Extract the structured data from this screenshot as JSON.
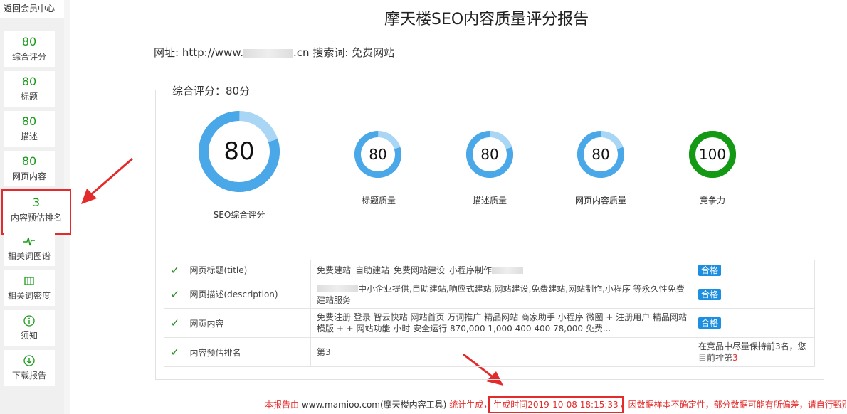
{
  "sidebar": {
    "back_label": "返回会员中心",
    "items": [
      {
        "score": "80",
        "label": "综合评分"
      },
      {
        "score": "80",
        "label": "标题"
      },
      {
        "score": "80",
        "label": "描述"
      },
      {
        "score": "80",
        "label": "网页内容"
      },
      {
        "score": "3",
        "label": "内容预估排名"
      },
      {
        "icon": "pulse-icon",
        "label": "相关词图谱"
      },
      {
        "icon": "grid-icon",
        "label": "相关词密度"
      },
      {
        "icon": "info-icon",
        "label": "须知"
      },
      {
        "icon": "download-icon",
        "label": "下载报告"
      }
    ]
  },
  "report": {
    "title": "摩天楼SEO内容质量评分报告",
    "url_label": "网址:",
    "url_prefix": "http://www.",
    "url_suffix": ".cn",
    "keyword_label": "搜索词:",
    "keyword": "免费网站"
  },
  "summary": {
    "legend": "综合评分：80分",
    "main_gauge": {
      "value": 80,
      "label": "SEO综合评分"
    },
    "gauges": [
      {
        "value": 80,
        "label": "标题质量",
        "color": "#4aa8e8"
      },
      {
        "value": 80,
        "label": "描述质量",
        "color": "#4aa8e8"
      },
      {
        "value": 80,
        "label": "网页内容质量",
        "color": "#4aa8e8"
      },
      {
        "value": 100,
        "label": "竞争力",
        "color": "#139913"
      }
    ]
  },
  "checks": [
    {
      "name": "网页标题(title)",
      "value": "免费建站_自助建站_免费网站建设_小程序制作",
      "result": "合格"
    },
    {
      "name": "网页描述(description)",
      "value": "中小企业提供,自助建站,响应式建站,网站建设,免费建站,网站制作,小程序 等永久性免费建站服务",
      "result": "合格"
    },
    {
      "name": "网页内容",
      "value": "免费注册 登录 智云快站 网站首页 万词推广 精品网站 商家助手 小程序 微圈 + 注册用户 精品网站模版 + + 网站功能 小时 安全运行 870,000 1,000 400 400 78,000 免费...",
      "result": "合格"
    },
    {
      "name": "内容预估排名",
      "value": "第3",
      "result_text": "在竞品中尽量保持前3名，您目前排第",
      "result_rank": "3"
    }
  ],
  "footer": {
    "prefix": "本报告由",
    "site": "www.mamioo.com(摩天楼内容工具)",
    "stat": "统计生成，",
    "time": "生成时间2019-10-08 18:15:33",
    "note": "，因数据样本不确定性，部分数据可能有所偏差，请自行甄别"
  },
  "colors": {
    "accent_green": "#1a9a1a",
    "gauge_blue": "#4aa8e8",
    "gauge_light": "#a9d6f5",
    "pass_blue": "#1e8fe0",
    "annotation_red": "#e42b2b"
  }
}
